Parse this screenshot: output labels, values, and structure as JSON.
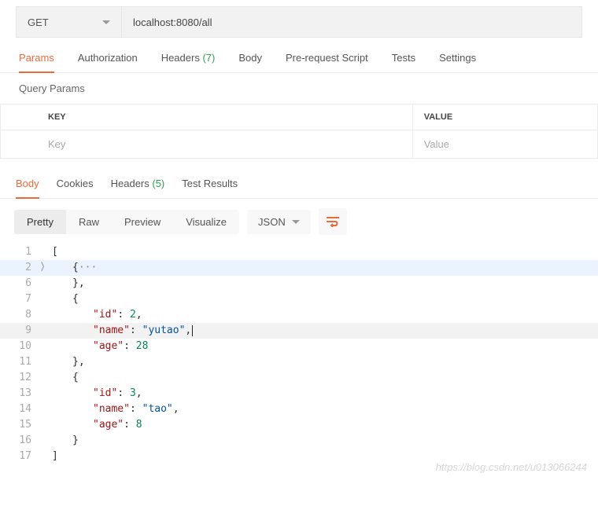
{
  "request": {
    "method": "GET",
    "url": "localhost:8080/all"
  },
  "tabs": {
    "params": "Params",
    "authorization": "Authorization",
    "headers": "Headers",
    "headers_count": "(7)",
    "body": "Body",
    "prerequest": "Pre-request Script",
    "tests": "Tests",
    "settings": "Settings"
  },
  "query_params": {
    "title": "Query Params",
    "header_key": "KEY",
    "header_value": "VALUE",
    "placeholder_key": "Key",
    "placeholder_value": "Value"
  },
  "response_tabs": {
    "body": "Body",
    "cookies": "Cookies",
    "headers": "Headers",
    "headers_count": "(5)",
    "test_results": "Test Results"
  },
  "view_modes": {
    "pretty": "Pretty",
    "raw": "Raw",
    "preview": "Preview",
    "visualize": "Visualize",
    "format": "JSON"
  },
  "response_data": [
    {
      "collapsed": true
    },
    {
      "id": 2,
      "name": "yutao",
      "age": 28
    },
    {
      "id": 3,
      "name": "tao",
      "age": 8
    }
  ],
  "code_lines": {
    "l1": "1",
    "l2": "2",
    "l6": "6",
    "l7": "7",
    "l8": "8",
    "l9": "9",
    "l10": "10",
    "l11": "11",
    "l12": "12",
    "l13": "13",
    "l14": "14",
    "l15": "15",
    "l16": "16",
    "l17": "17"
  },
  "tokens": {
    "open_bracket": "[",
    "close_bracket": "]",
    "open_brace": "{",
    "close_brace": "}",
    "close_brace_comma": "},",
    "comma": ",",
    "ellipsis": "···",
    "key_id": "\"id\"",
    "key_name": "\"name\"",
    "key_age": "\"age\"",
    "val_2": "2",
    "val_28": "28",
    "val_3": "3",
    "val_8": "8",
    "val_yutao": "\"yutao\"",
    "val_tao": "\"tao\"",
    "colon_space": ": "
  },
  "watermark": "https://blog.csdn.net/u013066244"
}
